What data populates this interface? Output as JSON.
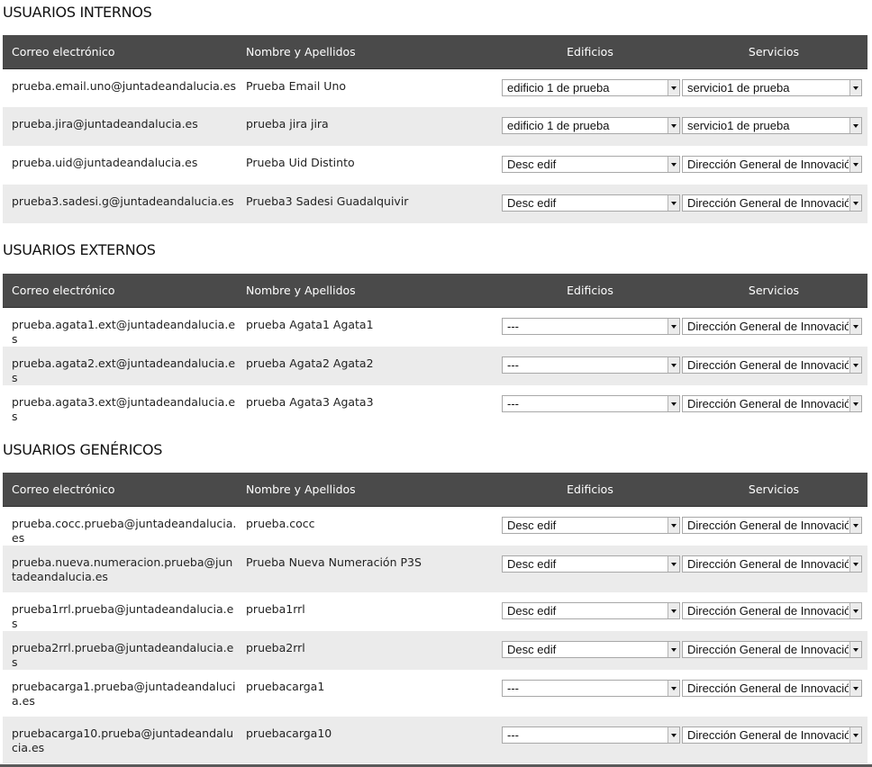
{
  "columns": {
    "email": "Correo electrónico",
    "name": "Nombre y Apellidos",
    "edificios": "Edificios",
    "servicios": "Servicios"
  },
  "sections": [
    {
      "title": "USUARIOS INTERNOS",
      "rows": [
        {
          "email": "prueba.email.uno@juntadeandalucia.es",
          "name": "Prueba Email Uno",
          "edificio": "edificio 1 de prueba",
          "servicio": "servicio1 de prueba"
        },
        {
          "email": "prueba.jira@juntadeandalucia.es",
          "name": "prueba jira jira",
          "edificio": "edificio 1 de prueba",
          "servicio": "servicio1 de prueba"
        },
        {
          "email": "prueba.uid@juntadeandalucia.es",
          "name": "Prueba Uid Distinto",
          "edificio": "Desc edif",
          "servicio": "Dirección General de Innovación"
        },
        {
          "email": "prueba3.sadesi.g@juntadeandalucia.es",
          "name": "Prueba3 Sadesi Guadalquivir",
          "edificio": "Desc edif",
          "servicio": "Dirección General de Innovación"
        }
      ]
    },
    {
      "title": "USUARIOS EXTERNOS",
      "rows": [
        {
          "email": "prueba.agata1.ext@juntadeandalucia.es",
          "name": "prueba Agata1 Agata1",
          "edificio": "---",
          "servicio": "Dirección General de Innovación"
        },
        {
          "email": "prueba.agata2.ext@juntadeandalucia.es",
          "name": "prueba Agata2 Agata2",
          "edificio": "---",
          "servicio": "Dirección General de Innovación"
        },
        {
          "email": "prueba.agata3.ext@juntadeandalucia.es",
          "name": "prueba Agata3 Agata3",
          "edificio": "---",
          "servicio": "Dirección General de Innovación"
        }
      ]
    },
    {
      "title": "USUARIOS GENÉRICOS",
      "rows": [
        {
          "email": "prueba.cocc.prueba@juntadeandalucia.es",
          "name": "prueba.cocc",
          "edificio": "Desc edif",
          "servicio": "Dirección General de Innovación"
        },
        {
          "email": "prueba.nueva.numeracion.prueba@juntadeandalucia.es",
          "name": "Prueba Nueva Numeración P3S",
          "edificio": "Desc edif",
          "servicio": "Dirección General de Innovación"
        },
        {
          "email": "prueba1rrl.prueba@juntadeandalucia.es",
          "name": "prueba1rrl",
          "edificio": "Desc edif",
          "servicio": "Dirección General de Innovación"
        },
        {
          "email": "prueba2rrl.prueba@juntadeandalucia.es",
          "name": "prueba2rrl",
          "edificio": "Desc edif",
          "servicio": "Dirección General de Innovación"
        },
        {
          "email": "pruebacarga1.prueba@juntadeandalucia.es",
          "name": "pruebacarga1",
          "edificio": "---",
          "servicio": "Dirección General de Innovación"
        },
        {
          "email": "pruebacarga10.prueba@juntadeandalucia.es",
          "name": "pruebacarga10",
          "edificio": "---",
          "servicio": "Dirección General de Innovación"
        }
      ]
    }
  ]
}
